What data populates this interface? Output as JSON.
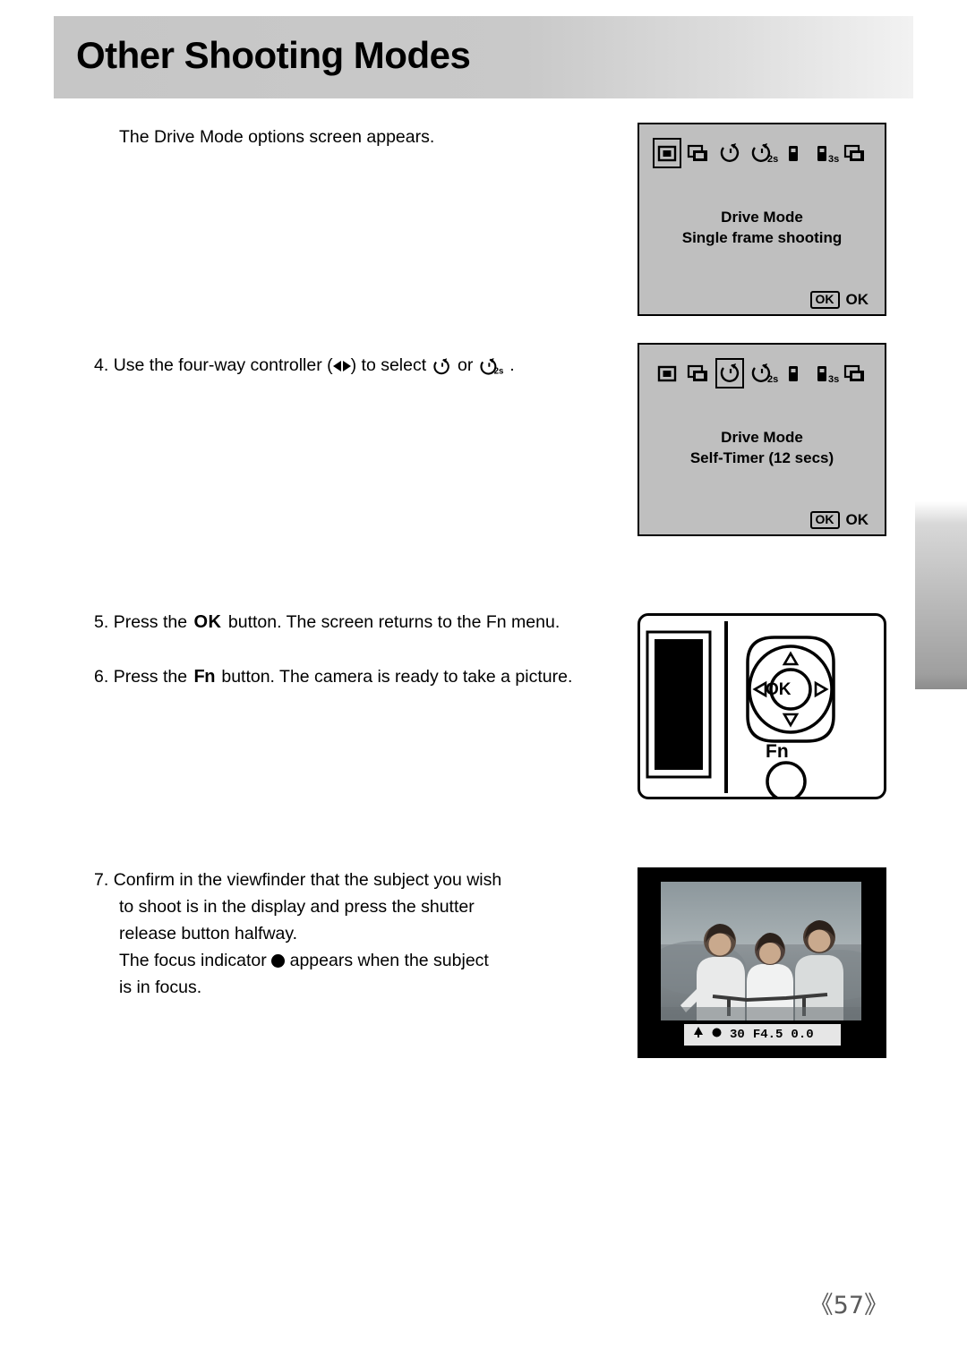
{
  "header": {
    "title": "Other Shooting Modes"
  },
  "page": {
    "number": "《57》"
  },
  "body": {
    "intro": "The Drive Mode options screen appears.",
    "step4": {
      "num": "4.",
      "text_before": "Use the four-way controller (",
      "text_mid": ") to select",
      "text_or": "or",
      "text_end": "."
    },
    "step5": {
      "num": "5.",
      "text_before": "Press the",
      "button": "OK",
      "text_after": "button. The screen returns to the Fn menu."
    },
    "step6": {
      "num": "6.",
      "text_before": "Press the",
      "button": "Fn",
      "text_after": "button. The camera is ready to take a picture."
    },
    "step7": {
      "num": "7.",
      "line1": "Confirm in the viewfinder that the subject you wish",
      "line2": "to shoot is in the display and press the shutter",
      "line3": "release button halfway.",
      "line4a": "The focus indicator",
      "line4b": "appears when the subject",
      "line5": "is in focus."
    }
  },
  "lcd1": {
    "title": "Drive Mode",
    "subtitle": "Single frame shooting",
    "ok_box": "OK",
    "ok_label": "OK",
    "icons": [
      {
        "name": "single-frame-icon",
        "selected": true
      },
      {
        "name": "continuous-shooting-icon",
        "selected": false
      },
      {
        "name": "self-timer-12s-icon",
        "selected": false
      },
      {
        "name": "self-timer-2s-icon",
        "selected": false,
        "label": "2s"
      },
      {
        "name": "remote-control-icon",
        "selected": false
      },
      {
        "name": "remote-control-3s-icon",
        "selected": false,
        "label": "3s"
      },
      {
        "name": "continuous-bracket-icon",
        "selected": false
      }
    ]
  },
  "lcd2": {
    "title": "Drive Mode",
    "subtitle": "Self-Timer (12 secs)",
    "ok_box": "OK",
    "ok_label": "OK",
    "icons": [
      {
        "name": "single-frame-icon",
        "selected": false
      },
      {
        "name": "continuous-shooting-icon",
        "selected": false
      },
      {
        "name": "self-timer-12s-icon",
        "selected": true
      },
      {
        "name": "self-timer-2s-icon",
        "selected": false,
        "label": "2s"
      },
      {
        "name": "remote-control-icon",
        "selected": false
      },
      {
        "name": "remote-control-3s-icon",
        "selected": false,
        "label": "3s"
      },
      {
        "name": "continuous-bracket-icon",
        "selected": false
      }
    ]
  },
  "camera": {
    "ok_button": "OK",
    "fn_label": "Fn"
  },
  "viewfinder": {
    "flash_icon": "flash-ready-icon",
    "focus_icon": "focus-indicator-icon",
    "shutter_speed": "30",
    "aperture": "F4.5",
    "exposure": "0.0"
  }
}
